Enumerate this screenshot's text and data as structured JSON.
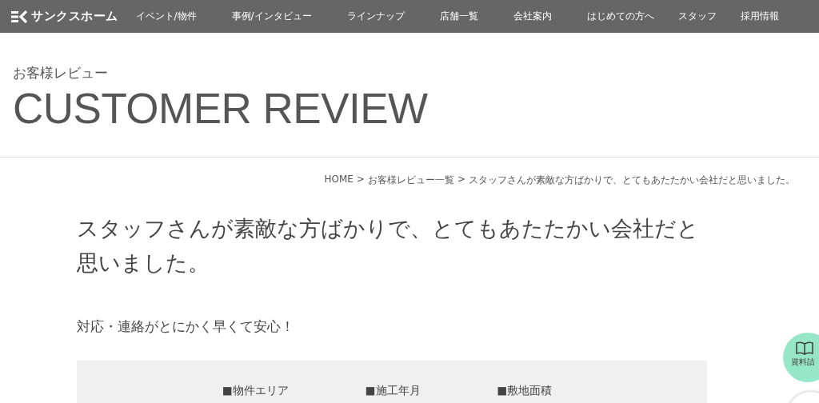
{
  "header": {
    "logo": "サンクスホーム",
    "nav": [
      {
        "label": "イベント/物件"
      },
      {
        "label": "事例/インタビュー"
      },
      {
        "label": "ラインナップ"
      },
      {
        "label": "店舗一覧"
      },
      {
        "label": "会社案内"
      },
      {
        "label": "はじめての方へ"
      },
      {
        "label": "スタッフ"
      },
      {
        "label": "採用情報"
      }
    ]
  },
  "page_title": {
    "subtitle": "お客様レビュー",
    "title": "CUSTOMER REVIEW"
  },
  "breadcrumb_separator": ">",
  "breadcrumb": [
    "HOME",
    "お客様レビュー一覧",
    "スタッフさんが素敵な方ばかりで、とてもあたたかい会社だと思いました。"
  ],
  "heading": "スタッフさんが素敵な方ばかりで、とてもあたたかい会社だと思いました。",
  "subheading": "対応・連絡がとにかく早くて安心！",
  "details": {
    "labels": [
      "■物件エリア",
      "■施工年月",
      "■敷地面積"
    ]
  },
  "floating_button": {
    "label": "資料請"
  }
}
